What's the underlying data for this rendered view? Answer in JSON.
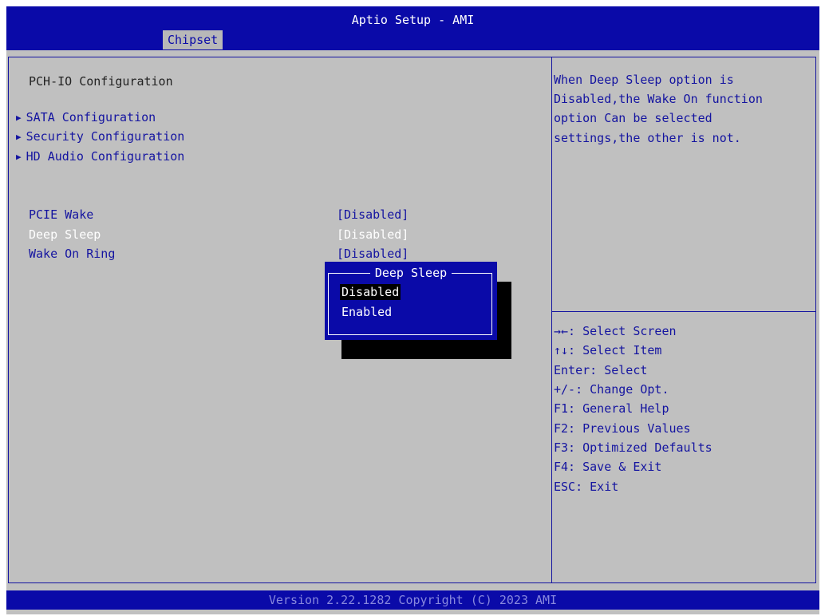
{
  "header": {
    "title": "Aptio Setup - AMI",
    "tab": "Chipset"
  },
  "page": {
    "title": "PCH-IO Configuration"
  },
  "submenus": [
    {
      "label": "SATA Configuration"
    },
    {
      "label": "Security Configuration"
    },
    {
      "label": "HD Audio Configuration"
    }
  ],
  "settings": [
    {
      "label": "PCIE Wake",
      "value": "[Disabled]"
    },
    {
      "label": "Deep Sleep",
      "value": "[Disabled]"
    },
    {
      "label": "Wake On Ring",
      "value": "[Disabled]"
    }
  ],
  "popup": {
    "title": "Deep Sleep",
    "options": [
      "Disabled",
      "Enabled"
    ],
    "selected": "Disabled"
  },
  "help": {
    "lines": [
      "When Deep Sleep option is",
      "Disabled,the Wake On function",
      "option Can be selected",
      "settings,the other is not."
    ]
  },
  "keys": [
    "→←: Select Screen",
    "↑↓: Select Item",
    "Enter: Select",
    "+/-: Change Opt.",
    "F1: General Help",
    "F2: Previous Values",
    "F3: Optimized Defaults",
    "F4: Save & Exit",
    "ESC: Exit"
  ],
  "footer": {
    "version": "Version 2.22.1282 Copyright (C) 2023 AMI"
  }
}
